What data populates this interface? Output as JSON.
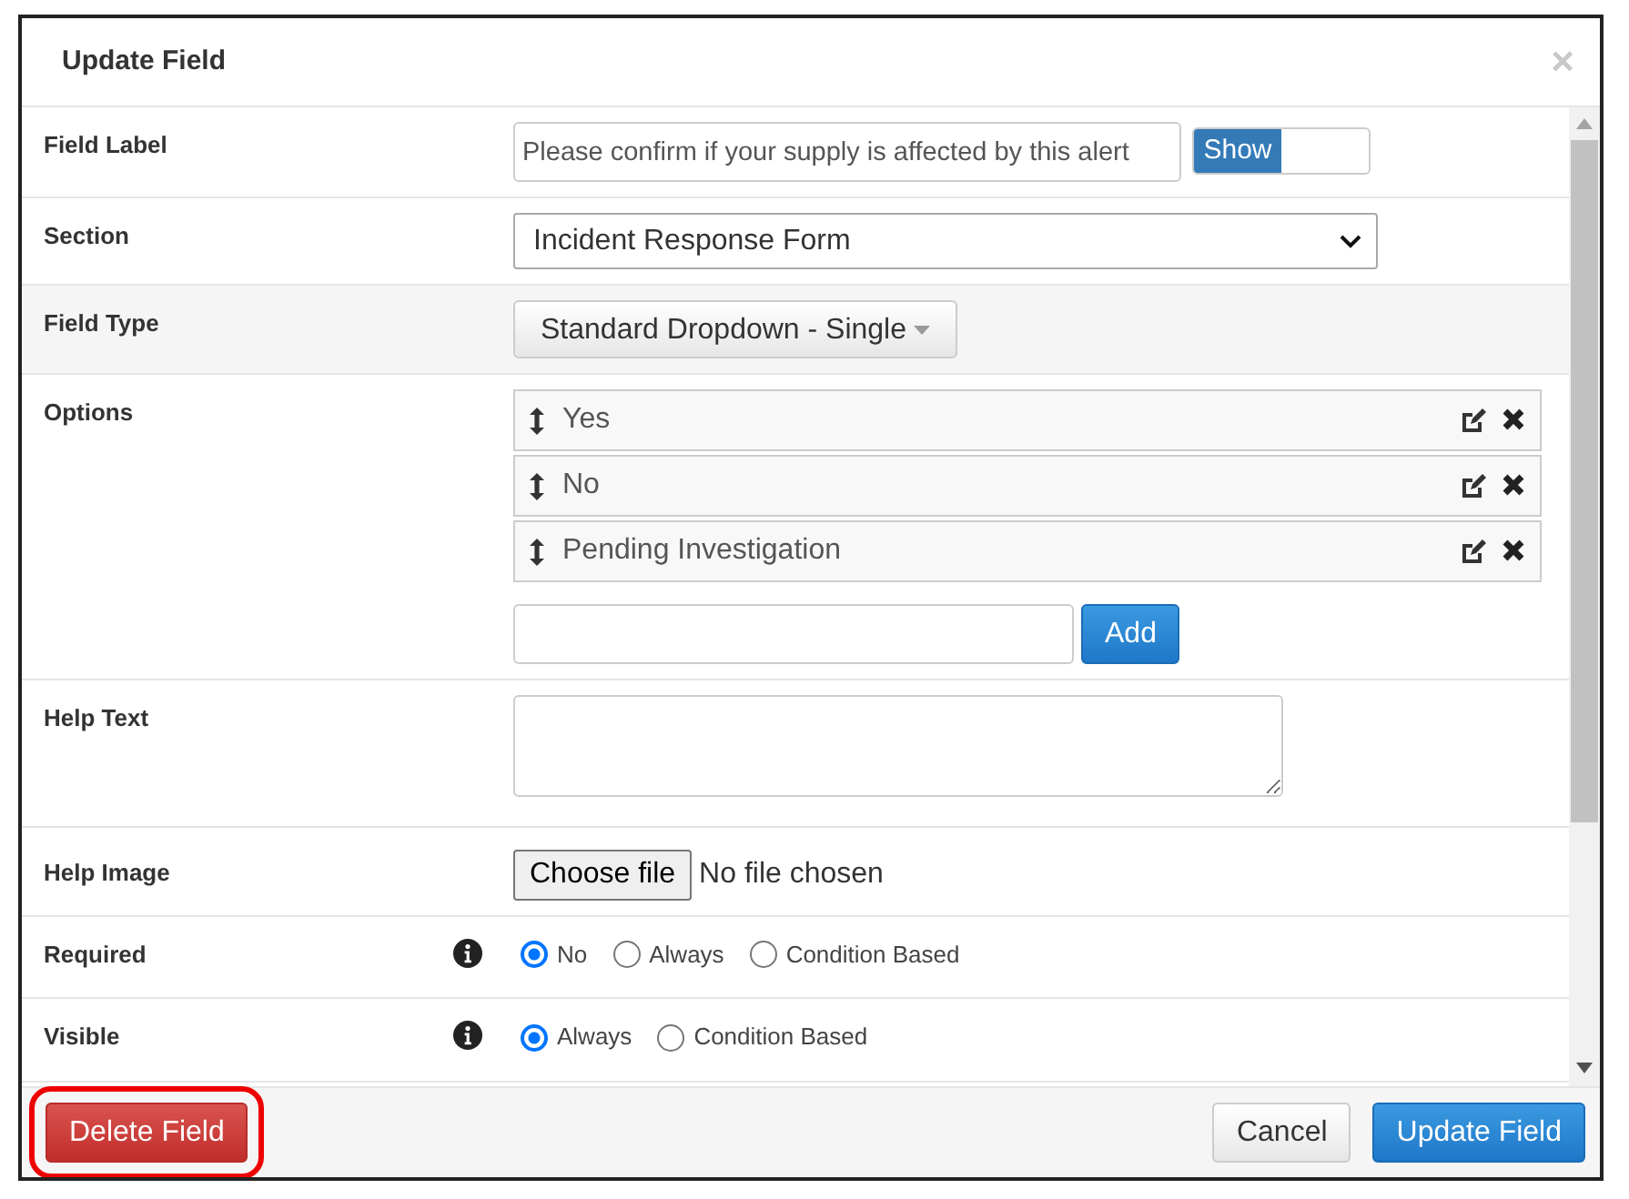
{
  "dialog": {
    "title": "Update Field",
    "close": "×"
  },
  "fields": [
    {
      "kind": "text_toggle",
      "label": "Field Label",
      "value": "Please confirm if your supply is affected by this alert",
      "toggle": {
        "label": "Show",
        "on": true
      }
    },
    {
      "kind": "select",
      "label": "Section",
      "value": "Incident Response Form"
    },
    {
      "kind": "dropdown",
      "label": "Field Type",
      "value": "Standard Dropdown - Single"
    },
    {
      "kind": "options",
      "label": "Options",
      "items": [
        {
          "text": "Yes"
        },
        {
          "text": "No"
        },
        {
          "text": "Pending Investigation"
        }
      ],
      "add_button": "Add"
    },
    {
      "kind": "textarea",
      "label": "Help Text"
    },
    {
      "kind": "file",
      "label": "Help Image",
      "button": "Choose file",
      "status": "No file chosen"
    },
    {
      "kind": "radios",
      "label": "Required",
      "info": true,
      "choices": [
        {
          "label": "No",
          "selected": true
        },
        {
          "label": "Always",
          "selected": false
        },
        {
          "label": "Condition Based",
          "selected": false
        }
      ]
    },
    {
      "kind": "radios",
      "label": "Visible",
      "info": true,
      "choices": [
        {
          "label": "Always",
          "selected": true
        },
        {
          "label": "Condition Based",
          "selected": false
        }
      ]
    }
  ],
  "footer": {
    "delete": "Delete Field",
    "cancel": "Cancel",
    "update": "Update Field"
  }
}
